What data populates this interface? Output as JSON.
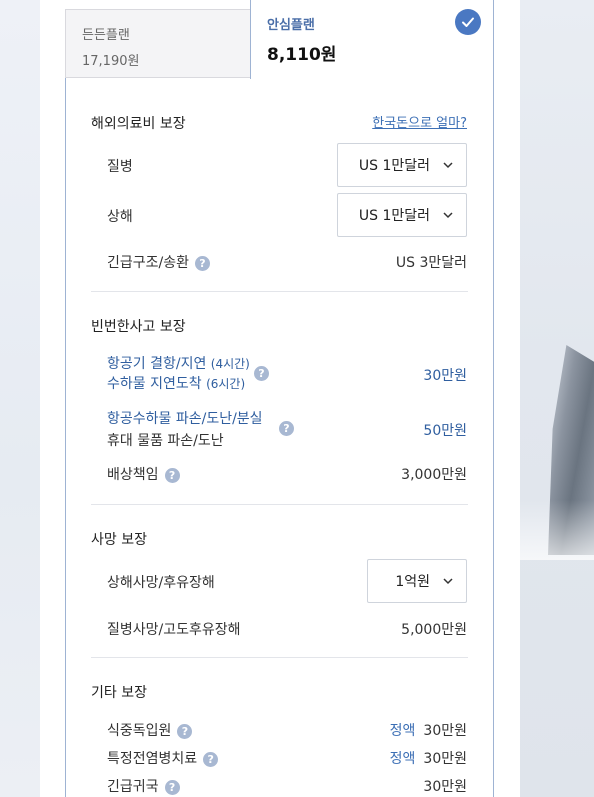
{
  "tabs": [
    {
      "name": "든든플랜",
      "price": "17,190원"
    },
    {
      "name": "안심플랜",
      "price": "8,110원"
    }
  ],
  "sections": {
    "overseas": {
      "title": "해외의료비 보장",
      "link": "한국돈으로 얼마?",
      "rows": [
        {
          "label": "질병",
          "value": "US 1만달러"
        },
        {
          "label": "상해",
          "value": "US 1만달러"
        },
        {
          "label": "긴급구조/송환",
          "value": "US 3만달러"
        }
      ]
    },
    "frequent": {
      "title": "빈번한사고 보장",
      "rows": [
        {
          "line1": "항공기 결항/지연",
          "line1_note": "(4시간)",
          "line2": "수하물 지연도착",
          "line2_note": "(6시간)",
          "value": "30만원"
        },
        {
          "line1": "항공수하물 파손/도난/분실",
          "line2": "휴대 물품 파손/도난",
          "value": "50만원"
        },
        {
          "label": "배상책임",
          "value": "3,000만원"
        }
      ]
    },
    "death": {
      "title": "사망 보장",
      "rows": [
        {
          "label": "상해사망/후유장해",
          "value": "1억원"
        },
        {
          "label": "질병사망/고도후유장해",
          "value": "5,000만원"
        }
      ]
    },
    "other": {
      "title": "기타 보장",
      "rows": [
        {
          "label": "식중독입원",
          "tag": "정액",
          "value": "30만원"
        },
        {
          "label": "특정전염병치료",
          "tag": "정액",
          "value": "30만원"
        },
        {
          "label": "긴급귀국",
          "value": "30만원"
        }
      ]
    }
  },
  "help_glyph": "?",
  "colors": {
    "accent": "#4a78c2",
    "link": "#3c6fb5",
    "help": "#a8b8d2"
  }
}
